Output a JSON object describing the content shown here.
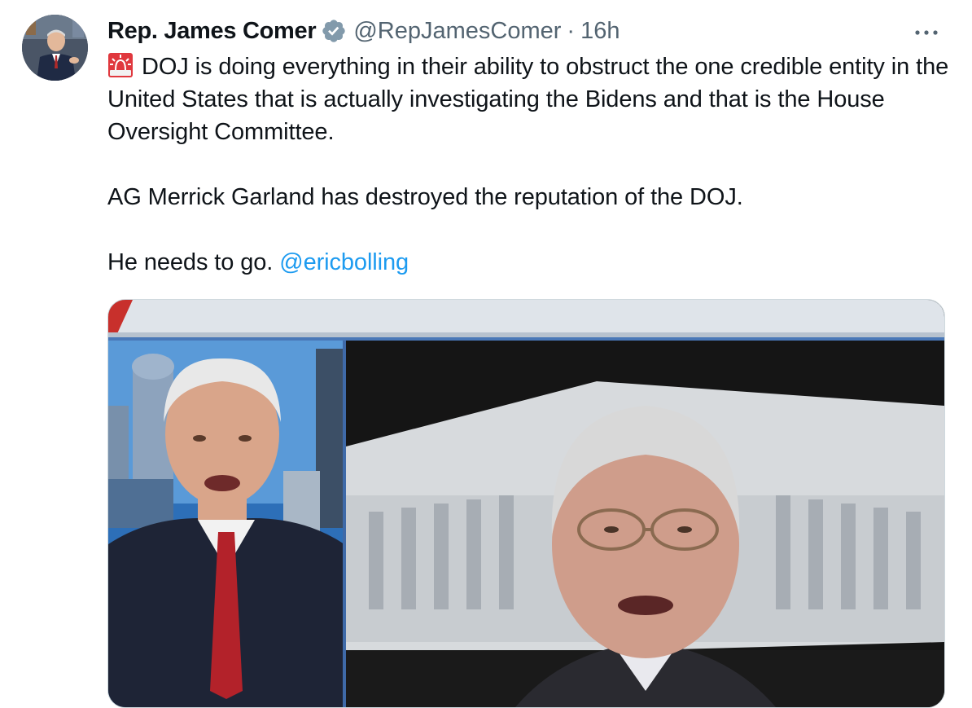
{
  "author": {
    "display_name": "Rep. James Comer",
    "handle": "@RepJamesComer",
    "separator": "·",
    "time_ago": "16h",
    "verified": true,
    "avatar_icon": "profile-photo"
  },
  "tweet": {
    "emoji_icon": "rotating-light-siren",
    "paragraph_1": "DOJ is doing everything in their ability to obstruct the one credible entity in the United States that is actually investigating the Bidens and that is the House Oversight Committee.",
    "paragraph_2": "AG Merrick Garland has destroyed the reputation of the DOJ.",
    "paragraph_3_text": "He needs to go.",
    "paragraph_3_mention": "@ericbolling"
  },
  "media": {
    "type": "video-still",
    "description_icon": "split-screen-news-broadcast"
  },
  "colors": {
    "link": "#1d9bf0",
    "secondary_text": "#536471",
    "verified_badge": "#829aab",
    "primary_text": "#0f1419"
  }
}
